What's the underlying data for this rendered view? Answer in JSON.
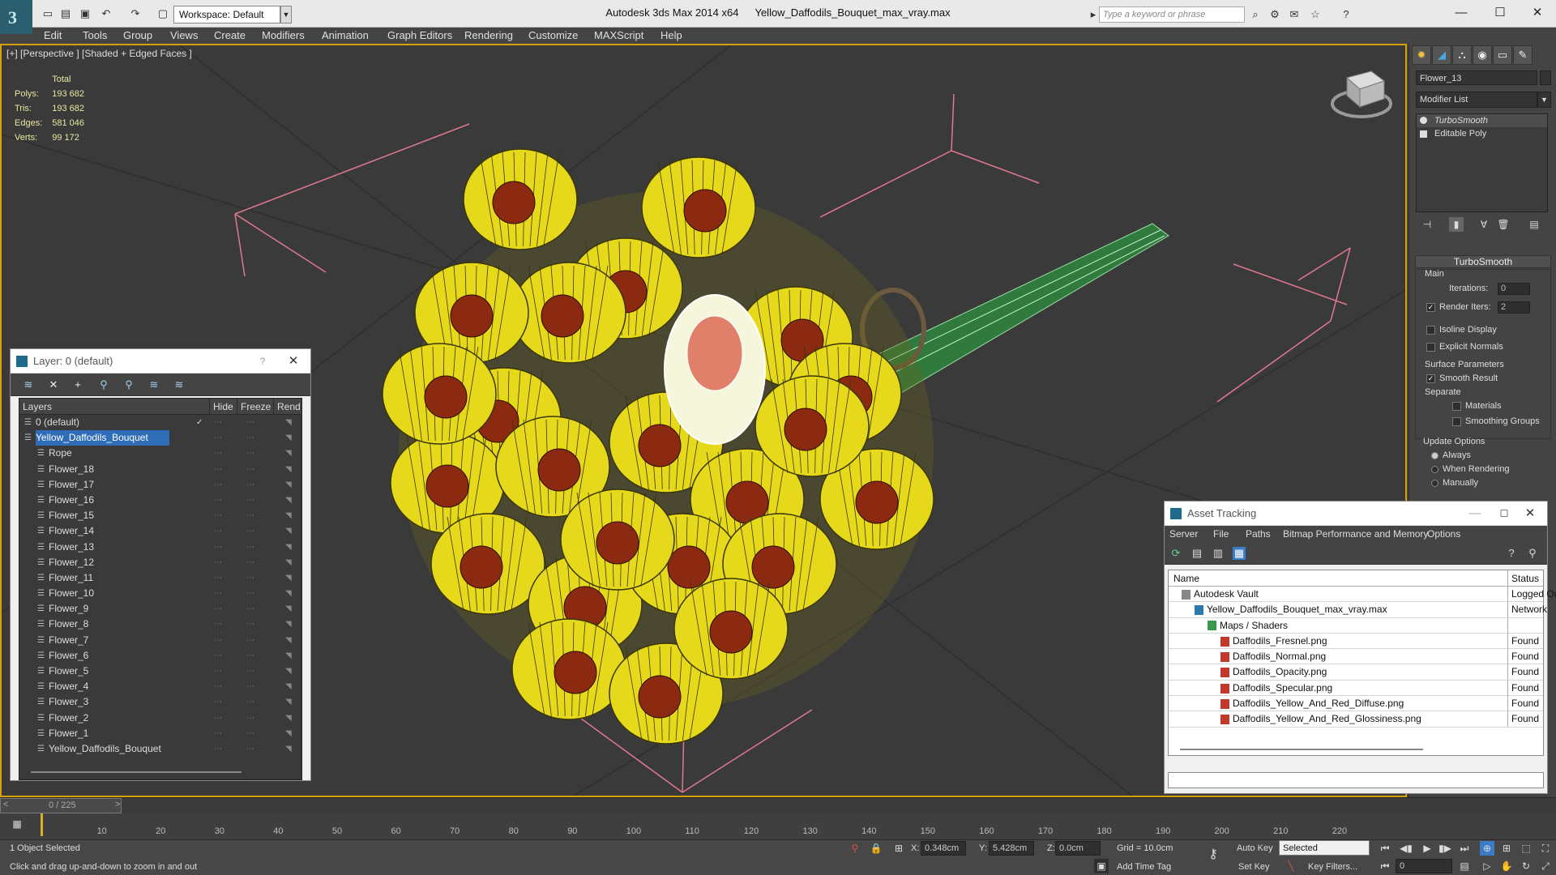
{
  "app": {
    "title": "Autodesk 3ds Max  2014 x64",
    "file": "Yellow_Daffodils_Bouquet_max_vray.max",
    "logo_letter": "3",
    "workspace": "Workspace: Default",
    "search_placeholder": "Type a keyword or phrase"
  },
  "menu": [
    "Edit",
    "Tools",
    "Group",
    "Views",
    "Create",
    "Modifiers",
    "Animation",
    "Graph Editors",
    "Rendering",
    "Customize",
    "MAXScript",
    "Help"
  ],
  "viewport": {
    "label": "[+] [Perspective ] [Shaded + Edged Faces ]",
    "stats_header": "Total",
    "stats": [
      {
        "k": "Polys:",
        "v": "193 682"
      },
      {
        "k": "Tris:",
        "v": "193 682"
      },
      {
        "k": "Edges:",
        "v": "581 046"
      },
      {
        "k": "Verts:",
        "v": "99 172"
      }
    ]
  },
  "command_panel": {
    "object_name": "Flower_13",
    "modifier_list": "Modifier List",
    "stack": [
      "TurboSmooth",
      "Editable Poly"
    ],
    "turbosmooth": {
      "title": "TurboSmooth",
      "main": "Main",
      "iterations_label": "Iterations:",
      "iterations": "0",
      "render_iters_label": "Render Iters:",
      "render_iters": "2",
      "isoline": "Isoline Display",
      "explicit": "Explicit Normals",
      "surface": "Surface Parameters",
      "smooth_result": "Smooth Result",
      "separate": "Separate",
      "materials": "Materials",
      "smoothing_groups": "Smoothing Groups",
      "update_options": "Update Options",
      "always": "Always",
      "when_rendering": "When Rendering",
      "manually": "Manually"
    }
  },
  "layer_manager": {
    "title": "Layer: 0 (default)",
    "help": "?",
    "columns": {
      "layers": "Layers",
      "hide": "Hide",
      "freeze": "Freeze",
      "render": "Rend"
    },
    "rows": [
      {
        "name": "0 (default)",
        "level": 1
      },
      {
        "name": "Yellow_Daffodils_Bouquet",
        "level": 1,
        "selected": true
      },
      {
        "name": "Rope",
        "level": 2
      },
      {
        "name": "Flower_18",
        "level": 2
      },
      {
        "name": "Flower_17",
        "level": 2
      },
      {
        "name": "Flower_16",
        "level": 2
      },
      {
        "name": "Flower_15",
        "level": 2
      },
      {
        "name": "Flower_14",
        "level": 2
      },
      {
        "name": "Flower_13",
        "level": 2
      },
      {
        "name": "Flower_12",
        "level": 2
      },
      {
        "name": "Flower_11",
        "level": 2
      },
      {
        "name": "Flower_10",
        "level": 2
      },
      {
        "name": "Flower_9",
        "level": 2
      },
      {
        "name": "Flower_8",
        "level": 2
      },
      {
        "name": "Flower_7",
        "level": 2
      },
      {
        "name": "Flower_6",
        "level": 2
      },
      {
        "name": "Flower_5",
        "level": 2
      },
      {
        "name": "Flower_4",
        "level": 2
      },
      {
        "name": "Flower_3",
        "level": 2
      },
      {
        "name": "Flower_2",
        "level": 2
      },
      {
        "name": "Flower_1",
        "level": 2
      },
      {
        "name": "Yellow_Daffodils_Bouquet",
        "level": 2
      }
    ]
  },
  "asset_tracking": {
    "title": "Asset Tracking",
    "menu": [
      "Server",
      "File",
      "Paths",
      "Bitmap Performance and Memory",
      "Options"
    ],
    "columns": {
      "name": "Name",
      "status": "Status"
    },
    "rows": [
      {
        "name": "Autodesk Vault",
        "status": "Logged Out",
        "level": 1,
        "icon": "vault-icon"
      },
      {
        "name": "Yellow_Daffodils_Bouquet_max_vray.max",
        "status": "Network",
        "level": 2,
        "icon": "max-file-icon"
      },
      {
        "name": "Maps / Shaders",
        "status": "",
        "level": 3,
        "icon": "maps-icon"
      },
      {
        "name": "Daffodils_Fresnel.png",
        "status": "Found",
        "level": 4,
        "icon": "png-icon"
      },
      {
        "name": "Daffodils_Normal.png",
        "status": "Found",
        "level": 4,
        "icon": "png-icon"
      },
      {
        "name": "Daffodils_Opacity.png",
        "status": "Found",
        "level": 4,
        "icon": "png-icon"
      },
      {
        "name": "Daffodils_Specular.png",
        "status": "Found",
        "level": 4,
        "icon": "png-icon"
      },
      {
        "name": "Daffodils_Yellow_And_Red_Diffuse.png",
        "status": "Found",
        "level": 4,
        "icon": "png-icon"
      },
      {
        "name": "Daffodils_Yellow_And_Red_Glossiness.png",
        "status": "Found",
        "level": 4,
        "icon": "png-icon"
      }
    ]
  },
  "timeline": {
    "frame": "0 / 225",
    "ticks": [
      "10",
      "20",
      "30",
      "40",
      "50",
      "60",
      "70",
      "80",
      "90",
      "100",
      "110",
      "120",
      "130",
      "140",
      "150",
      "160",
      "170",
      "180",
      "190",
      "200",
      "210",
      "220"
    ]
  },
  "status": {
    "selected": "1 Object Selected",
    "hint": "Click and drag up-and-down to zoom in and out",
    "x_label": "X:",
    "x": "0.348cm",
    "y_label": "Y:",
    "y": "5.428cm",
    "z_label": "Z:",
    "z": "0.0cm",
    "grid": "Grid = 10.0cm",
    "add_time_tag": "Add Time Tag",
    "auto_key": "Auto Key",
    "set_key": "Set Key",
    "selected_dropdown": "Selected",
    "key_filters": "Key Filters...",
    "frame_field": "0"
  },
  "colors": {
    "viewport_border": "#d8a000",
    "selection_blue": "#2f6db8",
    "flower_yellow": "#e6d81a",
    "flower_red": "#8b2a10",
    "stem_green": "#2f7a3c"
  }
}
